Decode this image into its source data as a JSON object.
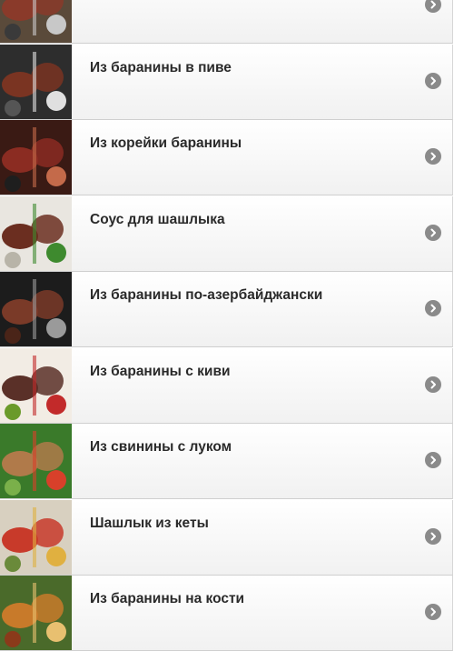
{
  "items": [
    {
      "label": "",
      "icon": "chevron-right-icon",
      "palette": [
        "#5a4a3a",
        "#8a3a2a",
        "#c8c8c8",
        "#3a3a3a"
      ]
    },
    {
      "label": "Из баранины в пиве",
      "icon": "chevron-right-icon",
      "palette": [
        "#2d2d2d",
        "#7a3422",
        "#e0e0e0",
        "#555555"
      ]
    },
    {
      "label": "Из корейки баранины",
      "icon": "chevron-right-icon",
      "palette": [
        "#3a1a14",
        "#8b2c22",
        "#c46a4a",
        "#1e1e1e"
      ]
    },
    {
      "label": "Соус для шашлыка",
      "icon": "chevron-right-icon",
      "palette": [
        "#e9e6e0",
        "#6b2e20",
        "#3e8a2e",
        "#b8b4a8"
      ]
    },
    {
      "label": "Из баранины по-азербайджански",
      "icon": "chevron-right-icon",
      "palette": [
        "#1c1c1c",
        "#7a3a28",
        "#9a9a9a",
        "#4a2418"
      ]
    },
    {
      "label": "Из баранины с киви",
      "icon": "chevron-right-icon",
      "palette": [
        "#f2ece4",
        "#5a3028",
        "#c22a2a",
        "#6a9a2a"
      ]
    },
    {
      "label": "Из свинины с луком",
      "icon": "chevron-right-icon",
      "palette": [
        "#3a7a2a",
        "#b07a4a",
        "#d8402a",
        "#7ab04a"
      ]
    },
    {
      "label": "Шашлык из кеты",
      "icon": "chevron-right-icon",
      "palette": [
        "#d8d0c0",
        "#c83a2a",
        "#e0b040",
        "#6a8a3a"
      ]
    },
    {
      "label": "Из баранины на кости",
      "icon": "chevron-right-icon",
      "palette": [
        "#4a6a2a",
        "#c87a2a",
        "#e8c070",
        "#8a3a1a"
      ]
    }
  ]
}
